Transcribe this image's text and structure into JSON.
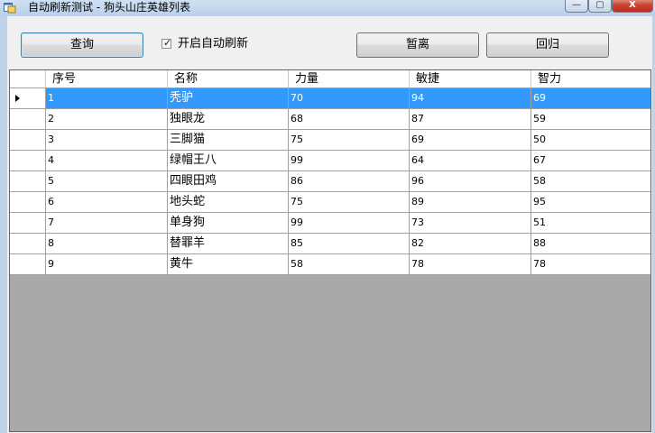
{
  "window": {
    "title": "自动刷新测试 - 狗头山庄英雄列表",
    "min_glyph": "—",
    "max_glyph": "▢",
    "close_glyph": "X"
  },
  "toolbar": {
    "query_label": "查询",
    "auto_refresh_label": "开启自动刷新",
    "auto_refresh_checked": true,
    "leave_label": "暂离",
    "return_label": "回归"
  },
  "grid": {
    "columns": [
      "序号",
      "名称",
      "力量",
      "敏捷",
      "智力"
    ],
    "selected_row": 0,
    "rows": [
      [
        "1",
        "秃驴",
        "70",
        "94",
        "69"
      ],
      [
        "2",
        "独眼龙",
        "68",
        "87",
        "59"
      ],
      [
        "3",
        "三脚猫",
        "75",
        "69",
        "50"
      ],
      [
        "4",
        "绿帽王八",
        "99",
        "64",
        "67"
      ],
      [
        "5",
        "四眼田鸡",
        "86",
        "96",
        "58"
      ],
      [
        "6",
        "地头蛇",
        "75",
        "89",
        "95"
      ],
      [
        "7",
        "单身狗",
        "99",
        "73",
        "51"
      ],
      [
        "8",
        "替罪羊",
        "85",
        "82",
        "88"
      ],
      [
        "9",
        "黄牛",
        "58",
        "78",
        "78"
      ]
    ]
  },
  "colors": {
    "selection": "#3399ff",
    "empty_grid_area": "#a9a9a9",
    "client_background": "#f0f0f0"
  }
}
